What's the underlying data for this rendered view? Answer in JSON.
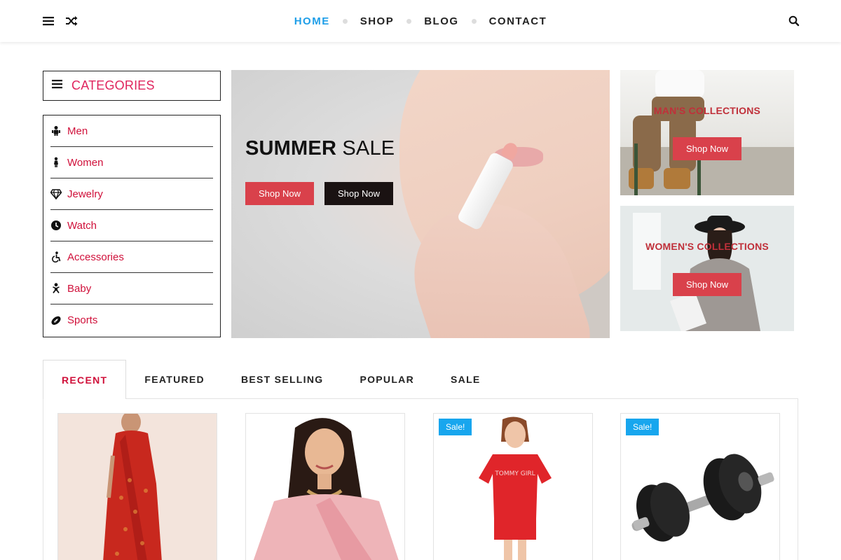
{
  "nav": {
    "items": [
      {
        "label": "HOME",
        "active": true
      },
      {
        "label": "SHOP",
        "active": false
      },
      {
        "label": "BLOG",
        "active": false
      },
      {
        "label": "CONTACT",
        "active": false
      }
    ],
    "icons": {
      "menu": "hamburger-icon",
      "shuffle": "shuffle-icon",
      "search": "search-icon"
    },
    "active_color": "#1e9ee8"
  },
  "categories": {
    "title": "CATEGORIES",
    "items": [
      {
        "label": "Men",
        "icon": "man-icon"
      },
      {
        "label": "Women",
        "icon": "woman-icon"
      },
      {
        "label": "Jewelry",
        "icon": "diamond-icon"
      },
      {
        "label": "Watch",
        "icon": "clock-icon"
      },
      {
        "label": "Accessories",
        "icon": "accessibility-icon"
      },
      {
        "label": "Baby",
        "icon": "baby-icon"
      },
      {
        "label": "Sports",
        "icon": "football-icon"
      }
    ],
    "accent_color": "#e0245e"
  },
  "hero": {
    "title_bold": "SUMMER",
    "title_rest": "SALE",
    "buttons": [
      {
        "label": "Shop Now",
        "color": "#d9414b"
      },
      {
        "label": "Shop Now",
        "color": "#1a1212"
      }
    ]
  },
  "banners": [
    {
      "title": "MAN'S COLLECTIONS",
      "button": "Shop Now"
    },
    {
      "title": "WOMEN'S COLLECTIONS",
      "button": "Shop Now"
    }
  ],
  "tabs": {
    "items": [
      {
        "label": "RECENT",
        "active": true
      },
      {
        "label": "FEATURED",
        "active": false
      },
      {
        "label": "BEST SELLING",
        "active": false
      },
      {
        "label": "POPULAR",
        "active": false
      },
      {
        "label": "SALE",
        "active": false
      }
    ]
  },
  "products": [
    {
      "name": "red-saree-product",
      "badge": ""
    },
    {
      "name": "pink-saree-product",
      "badge": ""
    },
    {
      "name": "red-tshirt-product",
      "badge": "Sale!",
      "shirt_text": "TOMMY GIRL"
    },
    {
      "name": "dumbbell-product",
      "badge": "Sale!"
    }
  ],
  "badge_color": "#18a6ee"
}
